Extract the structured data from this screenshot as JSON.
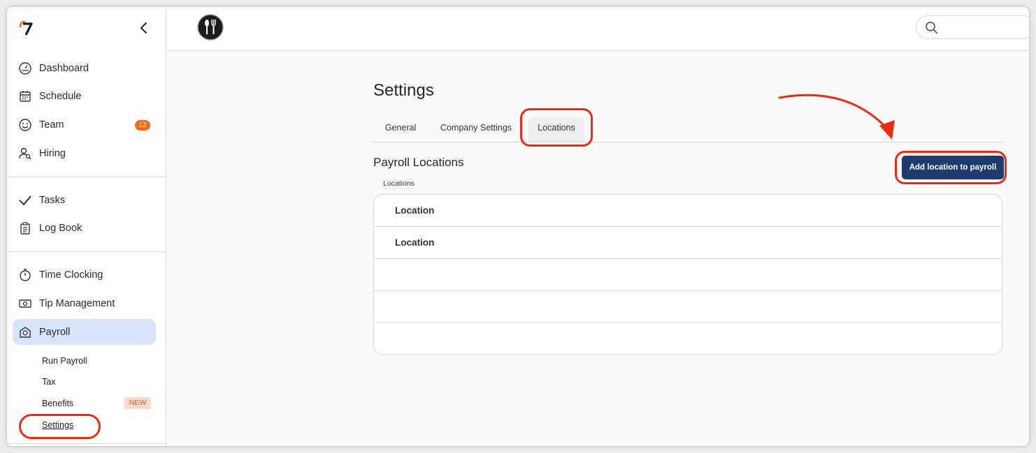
{
  "sidebar": {
    "logo_text": "7",
    "nav_main": [
      {
        "label": "Dashboard",
        "icon": "dashboard-gauge-icon"
      },
      {
        "label": "Schedule",
        "icon": "calendar-icon"
      },
      {
        "label": "Team",
        "icon": "smiley-icon",
        "badge": "12"
      },
      {
        "label": "Hiring",
        "icon": "person-search-icon"
      }
    ],
    "nav_ops": [
      {
        "label": "Tasks",
        "icon": "checkmark-icon"
      },
      {
        "label": "Log Book",
        "icon": "clipboard-icon"
      }
    ],
    "nav_money": [
      {
        "label": "Time Clocking",
        "icon": "stopwatch-icon"
      },
      {
        "label": "Tip Management",
        "icon": "cash-icon"
      },
      {
        "label": "Payroll",
        "icon": "payroll-envelope-icon"
      }
    ],
    "payroll_sub": [
      {
        "label": "Run Payroll"
      },
      {
        "label": "Tax"
      },
      {
        "label": "Benefits",
        "tag": "NEW"
      },
      {
        "label": "Settings"
      }
    ]
  },
  "header": {
    "avatar_icon": "restaurant-utensils-icon",
    "search_placeholder": ""
  },
  "main": {
    "title": "Settings",
    "tabs": [
      {
        "label": "General"
      },
      {
        "label": "Company Settings"
      },
      {
        "label": "Locations",
        "active": true
      }
    ],
    "section_title": "Payroll Locations",
    "section_sublabel": "Locations",
    "add_button_label": "Add location to payroll",
    "rows": [
      {
        "name": "Location"
      },
      {
        "name": "Location"
      },
      {
        "name": ""
      },
      {
        "name": ""
      },
      {
        "name": ""
      }
    ]
  },
  "colors": {
    "accent_orange": "#f26b1d",
    "primary_navy": "#1e3a6e",
    "active_nav_bg": "#d9e4fb",
    "annotation_red": "#ee2a13"
  }
}
